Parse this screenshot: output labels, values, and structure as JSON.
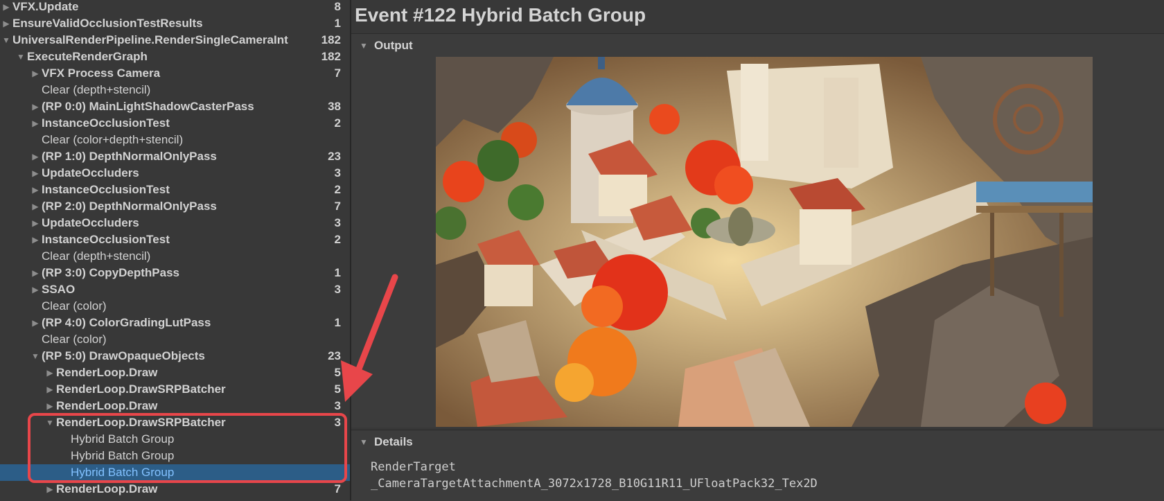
{
  "hierarchy": {
    "rows": [
      {
        "label": "VFX.Update",
        "count": "8",
        "arrow": "right",
        "bold": true,
        "selected": false
      },
      {
        "label": "EnsureValidOcclusionTestResults",
        "count": "1",
        "arrow": "right",
        "bold": true,
        "selected": false
      },
      {
        "label": "UniversalRenderPipeline.RenderSingleCameraInt",
        "count": "182",
        "arrow": "down",
        "bold": true,
        "selected": false
      },
      {
        "label": "ExecuteRenderGraph",
        "count": "182",
        "arrow": "down",
        "bold": true,
        "selected": false
      },
      {
        "label": "VFX Process Camera",
        "count": "7",
        "arrow": "right",
        "bold": true,
        "selected": false
      },
      {
        "label": "Clear (depth+stencil)",
        "count": "",
        "arrow": "none",
        "bold": false,
        "selected": false
      },
      {
        "label": "(RP 0:0) MainLightShadowCasterPass",
        "count": "38",
        "arrow": "right",
        "bold": true,
        "selected": false
      },
      {
        "label": "InstanceOcclusionTest",
        "count": "2",
        "arrow": "right",
        "bold": true,
        "selected": false
      },
      {
        "label": "Clear (color+depth+stencil)",
        "count": "",
        "arrow": "none",
        "bold": false,
        "selected": false
      },
      {
        "label": "(RP 1:0) DepthNormalOnlyPass",
        "count": "23",
        "arrow": "right",
        "bold": true,
        "selected": false
      },
      {
        "label": "UpdateOccluders",
        "count": "3",
        "arrow": "right",
        "bold": true,
        "selected": false
      },
      {
        "label": "InstanceOcclusionTest",
        "count": "2",
        "arrow": "right",
        "bold": true,
        "selected": false
      },
      {
        "label": "(RP 2:0) DepthNormalOnlyPass",
        "count": "7",
        "arrow": "right",
        "bold": true,
        "selected": false
      },
      {
        "label": "UpdateOccluders",
        "count": "3",
        "arrow": "right",
        "bold": true,
        "selected": false
      },
      {
        "label": "InstanceOcclusionTest",
        "count": "2",
        "arrow": "right",
        "bold": true,
        "selected": false
      },
      {
        "label": "Clear (depth+stencil)",
        "count": "",
        "arrow": "none",
        "bold": false,
        "selected": false
      },
      {
        "label": "(RP 3:0) CopyDepthPass",
        "count": "1",
        "arrow": "right",
        "bold": true,
        "selected": false
      },
      {
        "label": "SSAO",
        "count": "3",
        "arrow": "right",
        "bold": true,
        "selected": false
      },
      {
        "label": "Clear (color)",
        "count": "",
        "arrow": "none",
        "bold": false,
        "selected": false
      },
      {
        "label": "(RP 4:0) ColorGradingLutPass",
        "count": "1",
        "arrow": "right",
        "bold": true,
        "selected": false
      },
      {
        "label": "Clear (color)",
        "count": "",
        "arrow": "none",
        "bold": false,
        "selected": false
      },
      {
        "label": "(RP 5:0) DrawOpaqueObjects",
        "count": "23",
        "arrow": "down",
        "bold": true,
        "selected": false
      },
      {
        "label": "RenderLoop.Draw",
        "count": "5",
        "arrow": "right",
        "bold": true,
        "selected": false
      },
      {
        "label": "RenderLoop.DrawSRPBatcher",
        "count": "5",
        "arrow": "right",
        "bold": true,
        "selected": false
      },
      {
        "label": "RenderLoop.Draw",
        "count": "3",
        "arrow": "right",
        "bold": true,
        "selected": false
      },
      {
        "label": "RenderLoop.DrawSRPBatcher",
        "count": "3",
        "arrow": "down",
        "bold": true,
        "selected": false
      },
      {
        "label": "Hybrid Batch Group",
        "count": "",
        "arrow": "none",
        "bold": false,
        "selected": false
      },
      {
        "label": "Hybrid Batch Group",
        "count": "",
        "arrow": "none",
        "bold": false,
        "selected": false
      },
      {
        "label": "Hybrid Batch Group",
        "count": "",
        "arrow": "none",
        "bold": false,
        "selected": true
      },
      {
        "label": "RenderLoop.Draw",
        "count": "7",
        "arrow": "right",
        "bold": true,
        "selected": false
      }
    ]
  },
  "event": {
    "title": "Event #122 Hybrid Batch Group"
  },
  "output": {
    "header": "Output"
  },
  "details": {
    "header": "Details",
    "render_target_label": "RenderTarget",
    "render_target_value": "_CameraTargetAttachmentA_3072x1728_B10G11R11_UFloatPack32_Tex2D"
  },
  "icons": {
    "expanded": "chevron-down-icon",
    "collapsed": "chevron-right-icon"
  },
  "colors": {
    "selection": "#2c5d87",
    "selected_text": "#82c1ff",
    "annotation": "#e8464a"
  }
}
